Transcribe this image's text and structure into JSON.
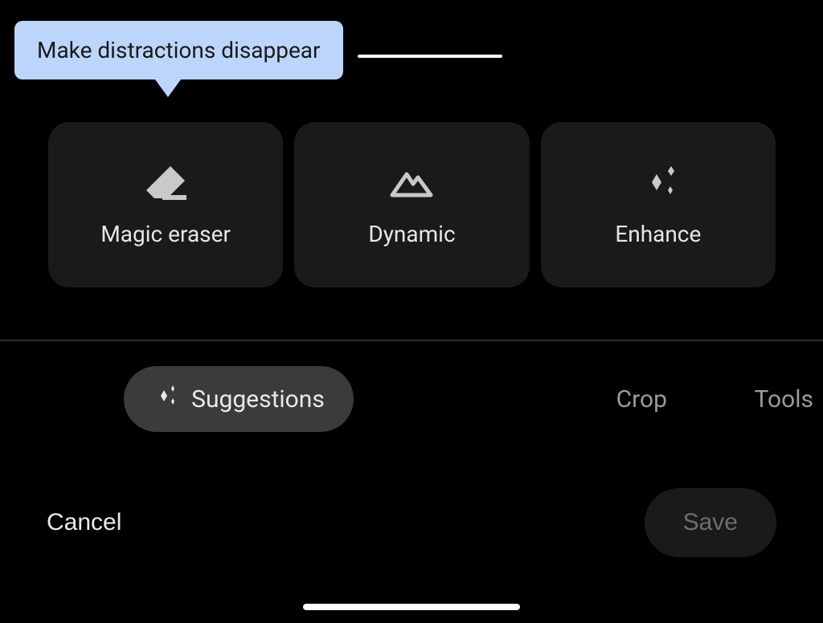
{
  "callout": {
    "text": "Make distractions disappear"
  },
  "cards": [
    {
      "icon": "eraser-icon",
      "label": "Magic eraser"
    },
    {
      "icon": "mountain-icon",
      "label": "Dynamic"
    },
    {
      "icon": "sparkle-icon",
      "label": "Enhance"
    }
  ],
  "tabs": {
    "active": {
      "icon": "sparkle-icon",
      "label": "Suggestions"
    },
    "crop": {
      "label": "Crop"
    },
    "tools": {
      "label": "Tools"
    }
  },
  "actions": {
    "cancel": "Cancel",
    "save": "Save"
  }
}
